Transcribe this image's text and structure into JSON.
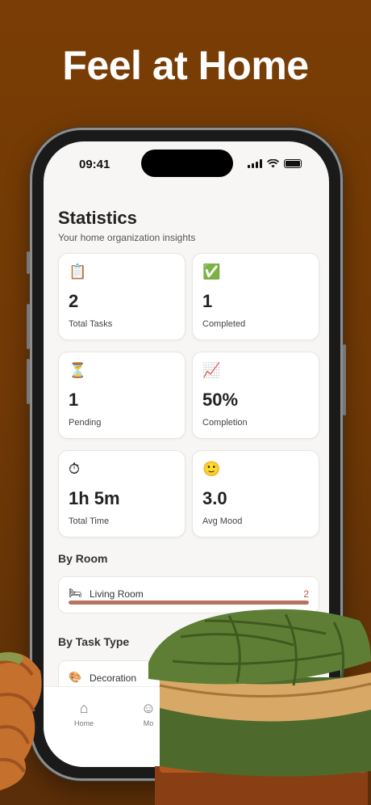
{
  "headline": "Feel at Home",
  "status_bar": {
    "time": "09:41"
  },
  "page": {
    "title": "Statistics",
    "subtitle": "Your home organization insights"
  },
  "stats": [
    {
      "icon": "clipboard-icon",
      "glyph": "📋",
      "value": "2",
      "label": "Total Tasks"
    },
    {
      "icon": "check-mark-icon",
      "glyph": "✅",
      "value": "1",
      "label": "Completed"
    },
    {
      "icon": "hourglass-icon",
      "glyph": "⏳",
      "value": "1",
      "label": "Pending"
    },
    {
      "icon": "chart-increasing-icon",
      "glyph": "📈",
      "value": "50%",
      "label": "Completion"
    },
    {
      "icon": "stopwatch-icon",
      "glyph": "⏱",
      "value": "1h 5m",
      "label": "Total Time"
    },
    {
      "icon": "smiley-icon",
      "glyph": "🙂",
      "value": "3.0",
      "label": "Avg Mood"
    }
  ],
  "by_room": {
    "heading": "By Room",
    "items": [
      {
        "icon": "bed-icon",
        "glyph": "🛏",
        "name": "Living Room",
        "count": "2",
        "progress": 1.0
      }
    ]
  },
  "by_task_type": {
    "heading": "By Task Type",
    "items": [
      {
        "icon": "palette-icon",
        "glyph": "🎨",
        "name": "Decoration"
      }
    ]
  },
  "tabbar": [
    {
      "icon": "home-icon",
      "glyph": "⌂",
      "label": "Home"
    },
    {
      "icon": "mood-icon",
      "glyph": "☺",
      "label": "Mo"
    }
  ],
  "colors": {
    "background": "#7a3d05",
    "accent": "#b8735e",
    "count": "#c0543a",
    "ottoman": "#5d7a3a"
  }
}
